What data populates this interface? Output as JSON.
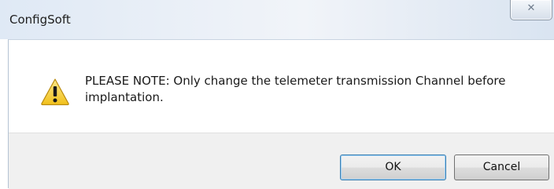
{
  "window": {
    "title": "ConfigSoft",
    "close_glyph": "✕"
  },
  "message": {
    "icon": "warning-icon",
    "text": "PLEASE NOTE:  Only change the telemeter transmission Channel before implantation."
  },
  "buttons": {
    "ok_label": "OK",
    "cancel_label": "Cancel"
  },
  "colors": {
    "titlebar": "#e4ebf4",
    "button_bar": "#f0f0f0",
    "warning_fill": "#f7d23c",
    "default_button_border": "#3c7fb1"
  }
}
